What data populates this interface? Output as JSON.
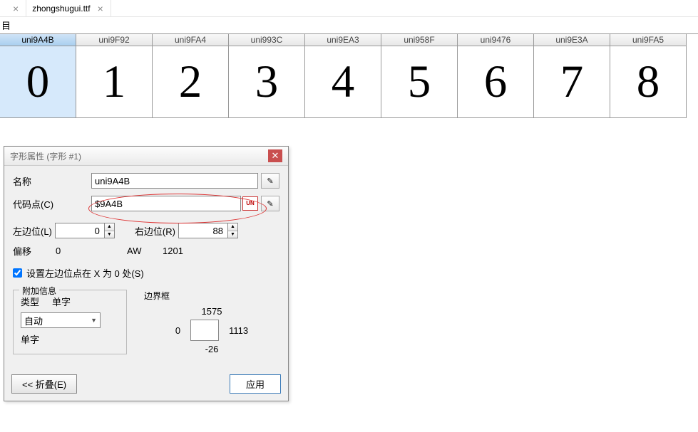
{
  "tabs": [
    {
      "label": ""
    },
    {
      "label": "zhongshugui.ttf"
    }
  ],
  "below_label": "目",
  "glyphs": [
    {
      "code": "uni9A4B",
      "display": "0",
      "selected": true
    },
    {
      "code": "uni9F92",
      "display": "1"
    },
    {
      "code": "uni9FA4",
      "display": "2"
    },
    {
      "code": "uni993C",
      "display": "3"
    },
    {
      "code": "uni9EA3",
      "display": "4"
    },
    {
      "code": "uni958F",
      "display": "5"
    },
    {
      "code": "uni9476",
      "display": "6"
    },
    {
      "code": "uni9E3A",
      "display": "7"
    },
    {
      "code": "uni9FA5",
      "display": "8"
    }
  ],
  "dialog": {
    "title": "字形属性 (字形 #1)",
    "name_label": "名称",
    "name_value": "uni9A4B",
    "codepoint_label": "代码点(C)",
    "codepoint_value": "$9A4B",
    "lsb_label": "左边位(L)",
    "lsb_value": "0",
    "rsb_label": "右边位(R)",
    "rsb_value": "88",
    "offset_label": "偏移",
    "offset_value": "0",
    "aw_label": "AW",
    "aw_value": "1201",
    "checkbox_label": "设置左边位点在 X 为 0 处(S)",
    "extra_title": "附加信息",
    "extra_row1_a": "类型",
    "extra_row1_b": "单字",
    "extra_dropdown": "自动",
    "extra_row3": "单字",
    "bbox_title": "边界框",
    "bbox_top": "1575",
    "bbox_left": "0",
    "bbox_right": "1113",
    "bbox_bottom": "-26",
    "collapse_btn": "<< 折叠(E)",
    "apply_btn": "应用",
    "unicode_badge": "UN"
  }
}
